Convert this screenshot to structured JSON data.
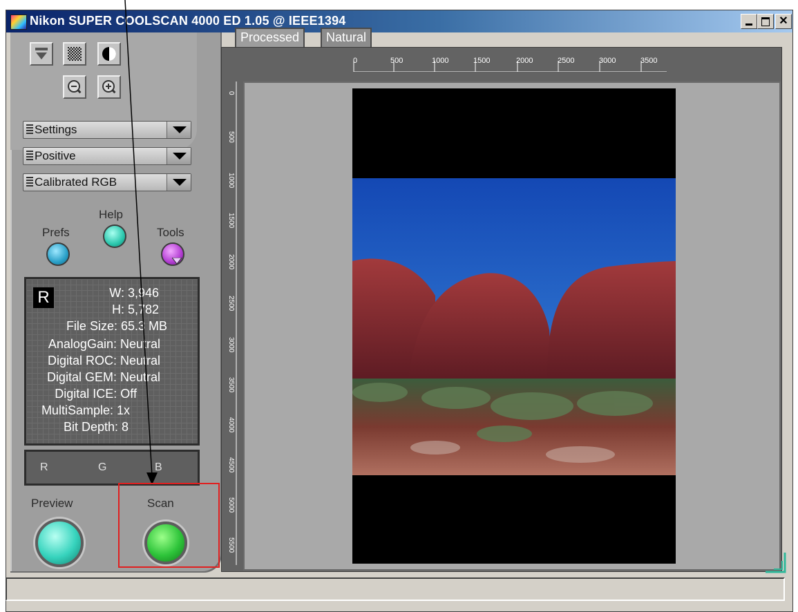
{
  "window": {
    "title": "Nikon SUPER COOLSCAN 4000 ED 1.05 @ IEEE1394"
  },
  "left_panel": {
    "dropdowns": [
      {
        "label": "Settings"
      },
      {
        "label": "Positive"
      },
      {
        "label": "Calibrated RGB"
      }
    ],
    "buttons": {
      "help": "Help",
      "prefs": "Prefs",
      "tools": "Tools",
      "preview": "Preview",
      "scan": "Scan"
    },
    "info": {
      "badge": "R",
      "width": "W: 3,946",
      "height": "H: 5,782",
      "file_size": "File Size: 65.3 MB",
      "analog_gain": "AnalogGain: Neutral",
      "digital_roc": "Digital ROC: Neutral",
      "digital_gem": "Digital GEM: Neutral",
      "digital_ice": "Digital ICE: Off",
      "multisample": "MultiSample: 1x",
      "bit_depth": "Bit Depth: 8"
    },
    "channels": [
      "R",
      "G",
      "B"
    ]
  },
  "viewer": {
    "tabs": [
      "Processed",
      "Natural"
    ],
    "ruler_h": [
      "0",
      "500",
      "1000",
      "1500",
      "2000",
      "2500",
      "3000",
      "3500"
    ],
    "ruler_v": [
      "0",
      "500",
      "1000",
      "1500",
      "2000",
      "2500",
      "3000",
      "3500",
      "4000",
      "4500",
      "5000",
      "5500"
    ]
  }
}
